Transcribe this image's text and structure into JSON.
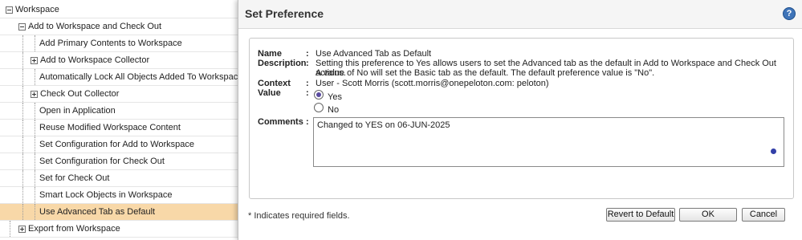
{
  "tree": {
    "items": [
      {
        "label": "Workspace",
        "toggle": "minus"
      },
      {
        "label": "Add to Workspace and Check Out",
        "toggle": "minus"
      },
      {
        "label": "Add Primary Contents to Workspace",
        "toggle": "none"
      },
      {
        "label": "Add to Workspace Collector",
        "toggle": "plus"
      },
      {
        "label": "Automatically Lock All Objects Added To Workspace",
        "toggle": "none"
      },
      {
        "label": "Check Out Collector",
        "toggle": "plus"
      },
      {
        "label": "Open in Application",
        "toggle": "none"
      },
      {
        "label": "Reuse Modified Workspace Content",
        "toggle": "none"
      },
      {
        "label": "Set Configuration for Add to Workspace",
        "toggle": "none"
      },
      {
        "label": "Set Configuration for Check Out",
        "toggle": "none"
      },
      {
        "label": "Set for Check Out",
        "toggle": "none"
      },
      {
        "label": "Smart Lock Objects in Workspace",
        "toggle": "none"
      },
      {
        "label": "Use Advanced Tab as Default",
        "toggle": "none",
        "selected": true
      },
      {
        "label": "Export from Workspace",
        "toggle": "plus"
      }
    ]
  },
  "dialog": {
    "title": "Set Preference",
    "help_icon": "question-circle-icon",
    "help_glyph": "?",
    "labels": {
      "name": "Name",
      "description": "Description",
      "context": "Context",
      "value": "Value",
      "comments": "Comments",
      "colon": ":"
    },
    "name_value": "Use Advanced Tab as Default",
    "description_lines": [
      "Setting this preference to Yes allows users to set the Advanced tab as the default in Add to Workspace and Check Out actions.",
      "A value of No will set the Basic tab as the default. The default preference value is \"No\"."
    ],
    "context_value": "User - Scott Morris (scott.morris@onepeloton.com: peloton)",
    "value_options": [
      {
        "label": "Yes",
        "checked": true
      },
      {
        "label": "No",
        "checked": false
      }
    ],
    "comments_value": "Changed to YES on 06-JUN-2025",
    "required_note": "* Indicates required fields.",
    "buttons": {
      "revert": "Revert to Default",
      "ok": "OK",
      "cancel": "Cancel"
    }
  },
  "colors": {
    "selected_row": "#f8d8a8",
    "help_icon": "#3f74b8",
    "radio_dot": "#5a4aa0"
  }
}
